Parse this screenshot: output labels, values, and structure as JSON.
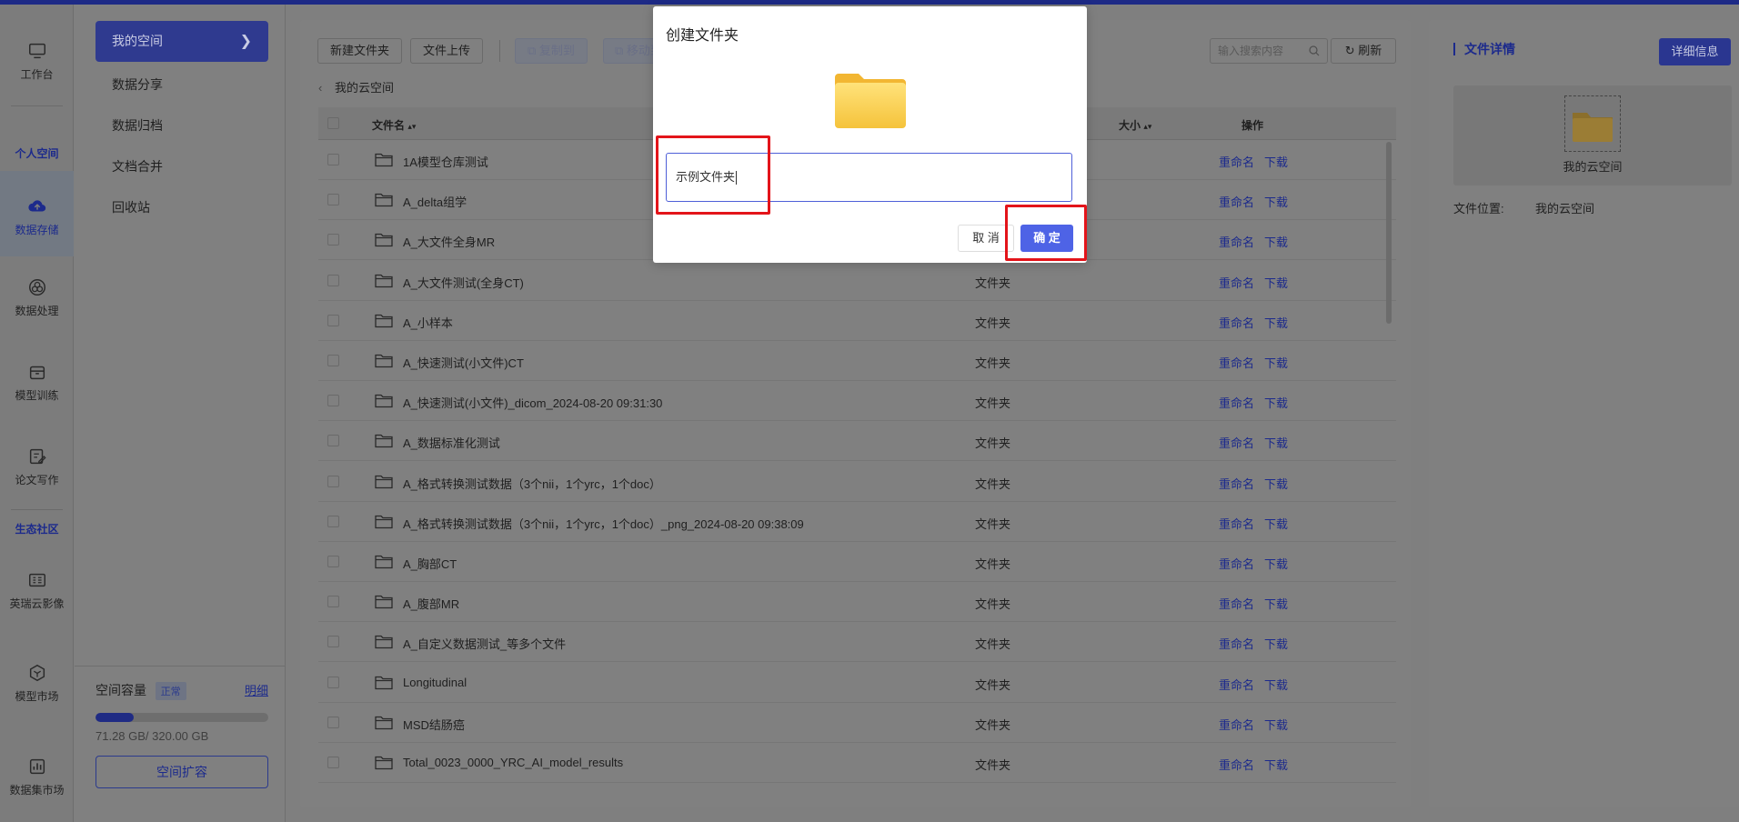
{
  "rail": {
    "items": [
      {
        "label": "工作台",
        "icon": "monitor-icon"
      },
      {
        "label": "数据存储",
        "icon": "cloud-upload-icon"
      },
      {
        "label": "数据处理",
        "icon": "data-process-icon"
      },
      {
        "label": "模型训练",
        "icon": "box-icon"
      },
      {
        "label": "论文写作",
        "icon": "edit-icon"
      },
      {
        "label": "英瑞云影像",
        "icon": "image-grid-icon"
      },
      {
        "label": "模型市场",
        "icon": "cube-icon"
      },
      {
        "label": "数据集市场",
        "icon": "bar-chart-icon"
      }
    ],
    "sections": [
      "个人空间",
      "生态社区"
    ]
  },
  "subnav": {
    "active": "我的空间",
    "items": [
      "数据分享",
      "数据归档",
      "文档合并",
      "回收站"
    ]
  },
  "storage": {
    "label": "空间容量",
    "status_badge": "正常",
    "detail_link": "明细",
    "used_text": "71.28 GB/ 320.00 GB",
    "used_fraction": 0.2228,
    "expand_button": "空间扩容"
  },
  "toolbar": {
    "new_folder": "新建文件夹",
    "upload": "文件上传",
    "copy_to": "复制到",
    "move_to": "移动到",
    "search_placeholder": "输入搜索内容",
    "refresh": "刷新"
  },
  "breadcrumb": "我的云空间",
  "table": {
    "headers": {
      "name": "文件名",
      "size": "大小",
      "actions": "操作"
    },
    "action_labels": {
      "rename": "重命名",
      "download": "下载"
    },
    "rows": [
      {
        "name": "1A模型仓库测试",
        "type": ""
      },
      {
        "name": "A_delta组学",
        "type": ""
      },
      {
        "name": "A_大文件全身MR",
        "type": ""
      },
      {
        "name": "A_大文件测试(全身CT)",
        "type": "文件夹"
      },
      {
        "name": "A_小样本",
        "type": "文件夹"
      },
      {
        "name": "A_快速测试(小文件)CT",
        "type": "文件夹"
      },
      {
        "name": "A_快速测试(小文件)_dicom_2024-08-20 09:31:30",
        "type": "文件夹"
      },
      {
        "name": "A_数据标准化测试",
        "type": "文件夹"
      },
      {
        "name": "A_格式转换测试数据（3个nii，1个yrc，1个doc）",
        "type": "文件夹"
      },
      {
        "name": "A_格式转换测试数据（3个nii，1个yrc，1个doc）_png_2024-08-20 09:38:09",
        "type": "文件夹"
      },
      {
        "name": "A_胸部CT",
        "type": "文件夹"
      },
      {
        "name": "A_腹部MR",
        "type": "文件夹"
      },
      {
        "name": "A_自定义数据测试_等多个文件",
        "type": "文件夹"
      },
      {
        "name": "Longitudinal",
        "type": "文件夹"
      },
      {
        "name": "MSD结肠癌",
        "type": "文件夹"
      },
      {
        "name": "Total_0023_0000_YRC_AI_model_results",
        "type": "文件夹"
      }
    ]
  },
  "details": {
    "title": "文件详情",
    "more_button": "详细信息",
    "preview_caption": "我的云空间",
    "location_label": "文件位置:",
    "location_value": "我的云空间"
  },
  "modal": {
    "title": "创建文件夹",
    "input_value": "示例文件夹",
    "cancel": "取 消",
    "ok": "确 定"
  },
  "colors": {
    "brand": "#2f3a8f",
    "link": "#1c2a8c",
    "ok_button": "#4e63e6",
    "highlight": "#e3141a"
  }
}
